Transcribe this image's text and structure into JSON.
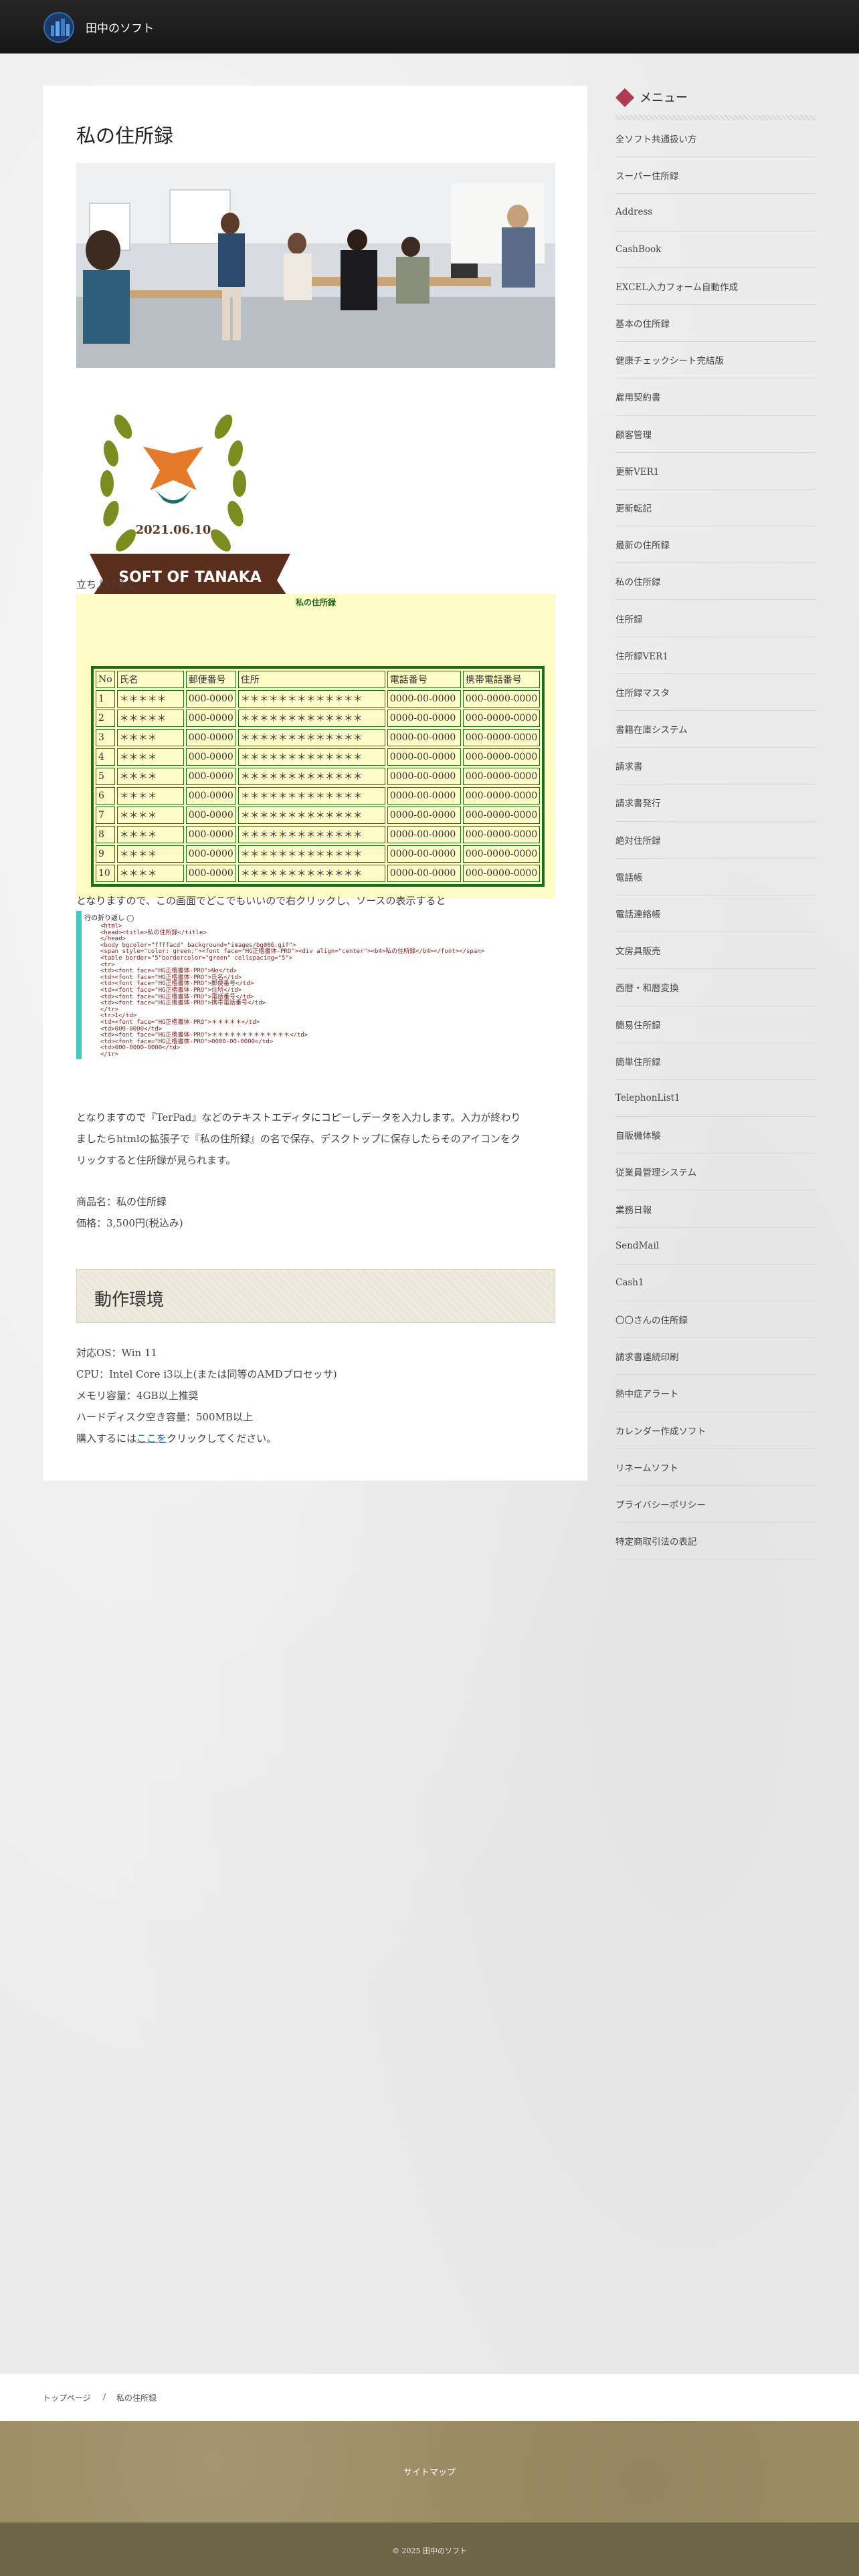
{
  "header": {
    "site_title": "田中のソフト"
  },
  "main": {
    "title": "私の住所録",
    "launch_text": "立ち上げると",
    "rightclick_text": "となりますので、この画面でどこでもいいので右クリックし、ソースの表示すると",
    "desc_line1": "となりますので『TerPad』などのテキストエディタにコピーしデータを入力します。入力が終わり",
    "desc_line2": "ましたらhtmlの拡張子で『私の住所録』の名で保存、デスクトップに保存したらそのアイコンをク",
    "desc_line3": "リックすると住所録が見られます。",
    "product_name": "商品名：私の住所録",
    "price": "価格：3,500円(税込み)",
    "section_title": "動作環境",
    "env_os": "対応OS：Win 11",
    "env_cpu": "CPU：Intel Core i3以上(または同等のAMDプロセッサ)",
    "env_mem": "メモリ容量：4GB以上推奨",
    "env_disk": "ハードディスク空き容量：500MB以上",
    "buy_prefix": "購入するには",
    "buy_link": "ここを",
    "buy_suffix": "クリックしてください。",
    "logo_date": "2021.06.10",
    "logo_banner": "SOFT OF TANAKA",
    "table": {
      "caption": "私の住所録",
      "headers": [
        "No",
        "氏名",
        "郵便番号",
        "住所",
        "電話番号",
        "携帯電話番号"
      ],
      "rows": [
        [
          "1",
          "＊＊＊＊＊",
          "000-0000",
          "＊＊＊＊＊＊＊＊＊＊＊＊＊",
          "0000-00-0000",
          "000-0000-0000"
        ],
        [
          "2",
          "＊＊＊＊＊",
          "000-0000",
          "＊＊＊＊＊＊＊＊＊＊＊＊＊",
          "0000-00-0000",
          "000-0000-0000"
        ],
        [
          "3",
          "＊＊＊＊",
          "000-0000",
          "＊＊＊＊＊＊＊＊＊＊＊＊＊",
          "0000-00-0000",
          "000-0000-0000"
        ],
        [
          "4",
          "＊＊＊＊",
          "000-0000",
          "＊＊＊＊＊＊＊＊＊＊＊＊＊",
          "0000-00-0000",
          "000-0000-0000"
        ],
        [
          "5",
          "＊＊＊＊",
          "000-0000",
          "＊＊＊＊＊＊＊＊＊＊＊＊＊",
          "0000-00-0000",
          "000-0000-0000"
        ],
        [
          "6",
          "＊＊＊＊",
          "000-0000",
          "＊＊＊＊＊＊＊＊＊＊＊＊＊",
          "0000-00-0000",
          "000-0000-0000"
        ],
        [
          "7",
          "＊＊＊＊",
          "000-0000",
          "＊＊＊＊＊＊＊＊＊＊＊＊＊",
          "0000-00-0000",
          "000-0000-0000"
        ],
        [
          "8",
          "＊＊＊＊",
          "000-0000",
          "＊＊＊＊＊＊＊＊＊＊＊＊＊",
          "0000-00-0000",
          "000-0000-0000"
        ],
        [
          "9",
          "＊＊＊＊",
          "000-0000",
          "＊＊＊＊＊＊＊＊＊＊＊＊＊",
          "0000-00-0000",
          "000-0000-0000"
        ],
        [
          "10",
          "＊＊＊＊",
          "000-0000",
          "＊＊＊＊＊＊＊＊＊＊＊＊＊",
          "0000-00-0000",
          "000-0000-0000"
        ]
      ]
    },
    "code": {
      "wrap_label": "行の折り返し",
      "lines": [
        "<html>",
        "<head><title>私の住所録</title>",
        "</head>",
        "<body bgcolor=\"ffffacd\" background=\"images/bg006.gif\">",
        "<span style=\"color: green;\"><font face=\"HG正楷書体-PRO\"><div align=\"center\"><b4>私の住所録</b4></font></span>",
        "<table border=\"5\"bordercolor=\"green\" cellspacing=\"5\">",
        "<tr>",
        "<td><font face=\"HG正楷書体-PRO\">No</td>",
        "<td><font face=\"HG正楷書体-PRO\">氏名</td>",
        "<td><font face=\"HG正楷書体-PRO\">郵便番号</td>",
        "<td><font face=\"HG正楷書体-PRO\">住所</td>",
        "<td><font face=\"HG正楷書体-PRO\">電話番号</td>",
        "<td><font face=\"HG正楷書体-PRO\">携帯電話番号</td>",
        "</tr>",
        "<tr>1</td>",
        "<td><font face=\"HG正楷書体-PRO\">＊＊＊＊＊</td>",
        "<td>000-0000</td>",
        "<td><font face=\"HG正楷書体-PRO\">＊＊＊＊＊＊＊＊＊＊＊＊＊</td>",
        "<td><font face=\"HG正楷書体-PRO\">0000-00-0000</td>",
        "<td>000-0000-0000</td>",
        "</tr>"
      ]
    }
  },
  "sidebar": {
    "heading": "メニュー",
    "items": [
      "全ソフト共通扱い方",
      "スーパー住所録",
      "Address",
      "CashBook",
      "EXCEL入力フォーム自動作成",
      "基本の住所録",
      "健康チェックシート完結版",
      "雇用契約書",
      "顧客管理",
      "更新VER1",
      "更新転記",
      "最新の住所録",
      "私の住所録",
      "住所録",
      "住所録VER1",
      "住所録マスタ",
      "書籍在庫システム",
      "請求書",
      "請求書発行",
      "絶対住所録",
      "電話帳",
      "電話連絡帳",
      "文房具販売",
      "西暦・和暦変換",
      "簡易住所録",
      "簡単住所録",
      "TelephonList1",
      "自販機体験",
      "従業員管理システム",
      "業務日報",
      "SendMail",
      "Cash1",
      "〇〇さんの住所録",
      "請求書連続印刷",
      "熱中症アラート",
      "カレンダー作成ソフト",
      "リネームソフト",
      "プライバシーポリシー",
      "特定商取引法の表記"
    ]
  },
  "breadcrumb": {
    "home": "トップページ",
    "sep": "/",
    "current": "私の住所録"
  },
  "footer": {
    "sitemap": "サイトマップ",
    "copyright": "© 2025 田中のソフト"
  },
  "colors": {
    "header": "#1e1e1e",
    "accent": "#b03a56",
    "footer": "#9c8d65",
    "footer_bottom": "#6f6548",
    "link": "#2a6fc9"
  }
}
